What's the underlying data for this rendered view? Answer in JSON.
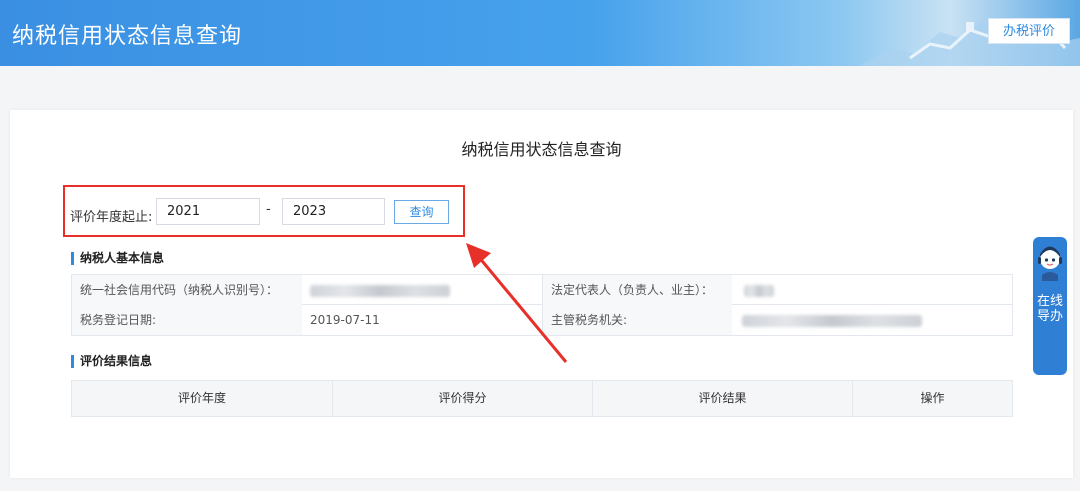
{
  "header": {
    "title": "纳税信用状态信息查询",
    "evaluate_button": "办税评价"
  },
  "main": {
    "title": "纳税信用状态信息查询",
    "query": {
      "label": "评价年度起止:",
      "start_year": "2021",
      "separator": "-",
      "end_year": "2023",
      "button": "查询"
    },
    "basic_info": {
      "heading": "纳税人基本信息",
      "credit_code_label": "统一社会信用代码（纳税人识别号）：",
      "legal_rep_label": "法定代表人（负责人、业主）：",
      "reg_date_label": "税务登记日期:",
      "reg_date_value": "2019-07-11",
      "tax_office_label": "主管税务机关:"
    },
    "result_info": {
      "heading": "评价结果信息",
      "columns": [
        "评价年度",
        "评价得分",
        "评价结果",
        "操作"
      ]
    }
  },
  "online_guide": {
    "label": "在线导办"
  },
  "colors": {
    "accent": "#2e8be0",
    "highlight": "#e8302a",
    "banner": "#3a8fe2"
  }
}
